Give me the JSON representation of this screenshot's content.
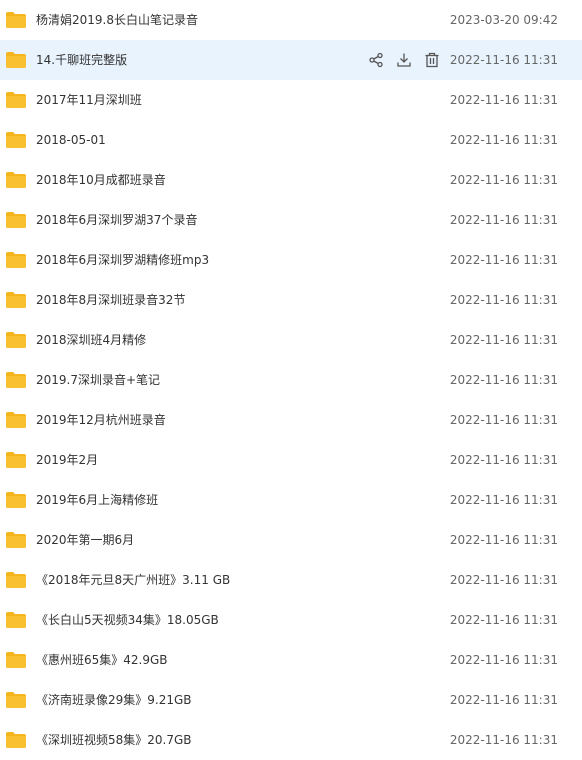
{
  "files": [
    {
      "name": "杨清娟2019.8长白山笔记录音",
      "date": "2023-03-20 09:42"
    },
    {
      "name": "14.千聊班完整版",
      "date": "2022-11-16 11:31",
      "hover": true
    },
    {
      "name": "2017年11月深圳班",
      "date": "2022-11-16 11:31"
    },
    {
      "name": "2018-05-01",
      "date": "2022-11-16 11:31"
    },
    {
      "name": "2018年10月成都班录音",
      "date": "2022-11-16 11:31"
    },
    {
      "name": "2018年6月深圳罗湖37个录音",
      "date": "2022-11-16 11:31"
    },
    {
      "name": "2018年6月深圳罗湖精修班mp3",
      "date": "2022-11-16 11:31"
    },
    {
      "name": "2018年8月深圳班录音32节",
      "date": "2022-11-16 11:31"
    },
    {
      "name": "2018深圳班4月精修",
      "date": "2022-11-16 11:31"
    },
    {
      "name": "2019.7深圳录音+笔记",
      "date": "2022-11-16 11:31"
    },
    {
      "name": "2019年12月杭州班录音",
      "date": "2022-11-16 11:31"
    },
    {
      "name": "2019年2月",
      "date": "2022-11-16 11:31"
    },
    {
      "name": "2019年6月上海精修班",
      "date": "2022-11-16 11:31"
    },
    {
      "name": "2020年第一期6月",
      "date": "2022-11-16 11:31"
    },
    {
      "name": "《2018年元旦8天广州班》3.11 GB",
      "date": "2022-11-16 11:31"
    },
    {
      "name": "《长白山5天视频34集》18.05GB",
      "date": "2022-11-16 11:31"
    },
    {
      "name": "《惠州班65集》42.9GB",
      "date": "2022-11-16 11:31"
    },
    {
      "name": "《济南班录像29集》9.21GB",
      "date": "2022-11-16 11:31"
    },
    {
      "name": "《深圳班视频58集》20.7GB",
      "date": "2022-11-16 11:31"
    }
  ],
  "icons": {
    "folder": "folder-icon",
    "share": "share-icon",
    "download": "download-icon",
    "delete": "trash-icon"
  },
  "colors": {
    "folder": "#f9c132",
    "folder_tab": "#f5b51f",
    "hover_row": "#e8f3fd",
    "action_icon": "#555555"
  }
}
